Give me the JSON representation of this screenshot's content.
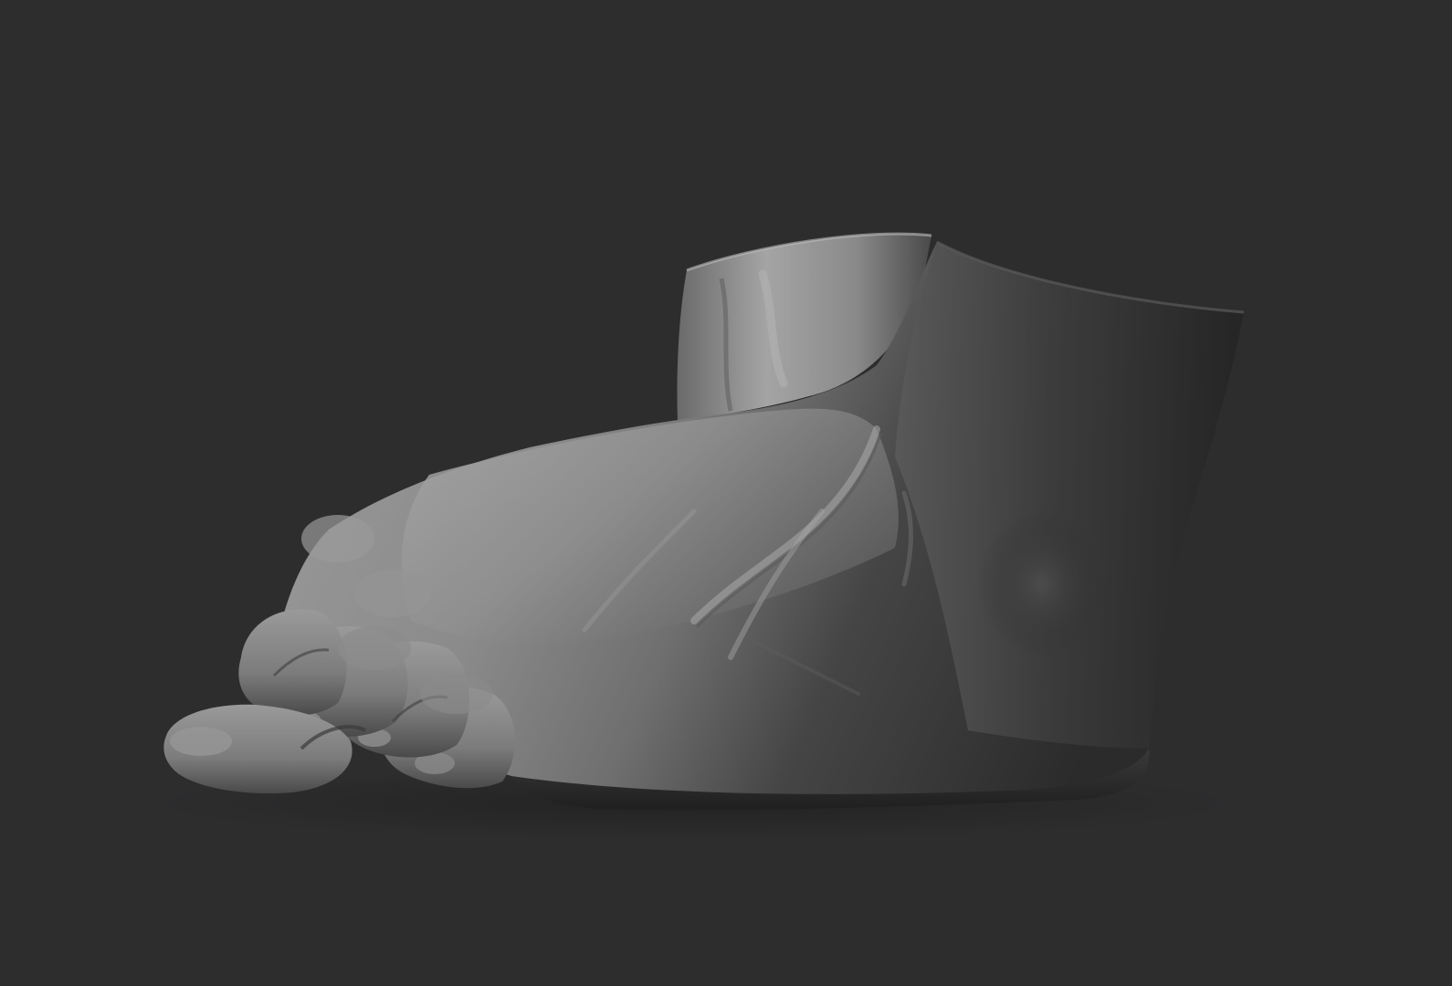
{
  "scene": {
    "subject_icon": "foot-sculpt-icon",
    "colors": {
      "background": "#2d2d2e",
      "clay_light": "#a9a9a9",
      "clay_mid": "#7a7a7a",
      "clay_dark": "#2f2f2f",
      "shadow": "#161616"
    }
  }
}
